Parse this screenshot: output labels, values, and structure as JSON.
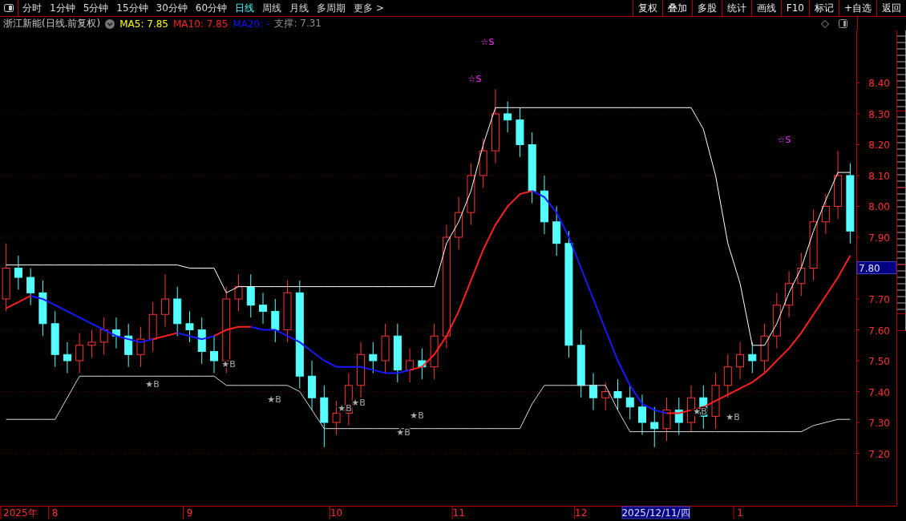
{
  "toolbar": {
    "periods": [
      {
        "label": "分时",
        "selected": false
      },
      {
        "label": "1分钟",
        "selected": false
      },
      {
        "label": "5分钟",
        "selected": false
      },
      {
        "label": "15分钟",
        "selected": false
      },
      {
        "label": "30分钟",
        "selected": false
      },
      {
        "label": "60分钟",
        "selected": false
      },
      {
        "label": "日线",
        "selected": true
      },
      {
        "label": "周线",
        "selected": false
      },
      {
        "label": "月线",
        "selected": false
      },
      {
        "label": "多周期",
        "selected": false
      },
      {
        "label": "更多 >",
        "selected": false
      }
    ],
    "buttons": [
      "复权",
      "叠加",
      "多股",
      "统计",
      "画线",
      "F10",
      "标记",
      "+自选",
      "返回"
    ]
  },
  "legend": {
    "title": "浙江新能(日线.前复权)",
    "items": [
      {
        "label": "MA5: 7.85",
        "color": "#ffff00"
      },
      {
        "label": "MA10: 7.85",
        "color": "#ff2020"
      },
      {
        "label": "MA20: -",
        "color": "#1010ff"
      },
      {
        "label": "支撑: 7.31",
        "color": "#909090"
      }
    ]
  },
  "chart": {
    "year_label": "2025年",
    "current_price": "7.80",
    "cursor_date": "2025/12/11/四",
    "chart_data": {
      "type": "candlestick",
      "grid": true,
      "ylim": [
        7.03,
        8.57
      ],
      "categories": [
        null,
        null,
        null,
        null,
        "8",
        null,
        null,
        null,
        null,
        null,
        null,
        null,
        null,
        null,
        null,
        "9",
        null,
        null,
        null,
        null,
        null,
        null,
        null,
        null,
        null,
        null,
        null,
        "10",
        null,
        null,
        null,
        null,
        null,
        null,
        null,
        null,
        null,
        "11",
        null,
        null,
        null,
        null,
        null,
        null,
        null,
        null,
        null,
        "12",
        null,
        null,
        null,
        null,
        null,
        null,
        null,
        null,
        null,
        null,
        null,
        null,
        "1",
        null,
        null,
        null,
        null,
        null,
        null,
        null,
        null,
        null
      ],
      "yticks": [
        {
          "value": 7.2,
          "label": "7.20"
        },
        {
          "value": 7.3,
          "label": "7.30"
        },
        {
          "value": 7.4,
          "label": "7.40"
        },
        {
          "value": 7.5,
          "label": "7.50"
        },
        {
          "value": 7.6,
          "label": "7.60"
        },
        {
          "value": 7.7,
          "label": "7.70"
        },
        {
          "value": 7.9,
          "label": "7.90"
        },
        {
          "value": 8.0,
          "label": "8.00"
        },
        {
          "value": 8.1,
          "label": "8.10"
        },
        {
          "value": 8.2,
          "label": "8.20"
        },
        {
          "value": 8.3,
          "label": "8.30"
        },
        {
          "value": 8.4,
          "label": "8.40"
        }
      ],
      "ohlc": [
        [
          7.7,
          7.88,
          7.66,
          7.8
        ],
        [
          7.8,
          7.84,
          7.73,
          7.77
        ],
        [
          7.77,
          7.8,
          7.68,
          7.72
        ],
        [
          7.72,
          7.76,
          7.58,
          7.62
        ],
        [
          7.62,
          7.66,
          7.48,
          7.52
        ],
        [
          7.52,
          7.56,
          7.46,
          7.5
        ],
        [
          7.5,
          7.59,
          7.46,
          7.55
        ],
        [
          7.55,
          7.6,
          7.51,
          7.56
        ],
        [
          7.56,
          7.64,
          7.52,
          7.6
        ],
        [
          7.6,
          7.64,
          7.54,
          7.58
        ],
        [
          7.58,
          7.62,
          7.48,
          7.52
        ],
        [
          7.52,
          7.61,
          7.48,
          7.57
        ],
        [
          7.57,
          7.69,
          7.53,
          7.65
        ],
        [
          7.65,
          7.78,
          7.61,
          7.7
        ],
        [
          7.7,
          7.74,
          7.58,
          7.62
        ],
        [
          7.62,
          7.66,
          7.56,
          7.6
        ],
        [
          7.6,
          7.64,
          7.49,
          7.53
        ],
        [
          7.53,
          7.58,
          7.46,
          7.5
        ],
        [
          7.5,
          7.74,
          7.46,
          7.7
        ],
        [
          7.7,
          7.78,
          7.66,
          7.74
        ],
        [
          7.74,
          7.78,
          7.64,
          7.68
        ],
        [
          7.68,
          7.72,
          7.62,
          7.66
        ],
        [
          7.66,
          7.7,
          7.56,
          7.6
        ],
        [
          7.6,
          7.76,
          7.56,
          7.72
        ],
        [
          7.72,
          7.76,
          7.41,
          7.45
        ],
        [
          7.45,
          7.5,
          7.34,
          7.38
        ],
        [
          7.38,
          7.42,
          7.22,
          7.3
        ],
        [
          7.3,
          7.37,
          7.26,
          7.33
        ],
        [
          7.33,
          7.46,
          7.29,
          7.42
        ],
        [
          7.42,
          7.56,
          7.38,
          7.52
        ],
        [
          7.52,
          7.56,
          7.46,
          7.5
        ],
        [
          7.5,
          7.62,
          7.46,
          7.58
        ],
        [
          7.58,
          7.62,
          7.43,
          7.47
        ],
        [
          7.47,
          7.54,
          7.43,
          7.5
        ],
        [
          7.5,
          7.54,
          7.44,
          7.48
        ],
        [
          7.48,
          7.62,
          7.44,
          7.58
        ],
        [
          7.58,
          7.94,
          7.54,
          7.9
        ],
        [
          7.9,
          8.03,
          7.86,
          7.98
        ],
        [
          7.98,
          8.14,
          7.94,
          8.1
        ],
        [
          8.1,
          8.22,
          8.06,
          8.18
        ],
        [
          8.18,
          8.38,
          8.14,
          8.3
        ],
        [
          8.3,
          8.34,
          8.24,
          8.28
        ],
        [
          8.28,
          8.32,
          8.16,
          8.2
        ],
        [
          8.2,
          8.24,
          8.01,
          8.05
        ],
        [
          8.05,
          8.1,
          7.91,
          7.95
        ],
        [
          7.95,
          8.0,
          7.84,
          7.88
        ],
        [
          7.88,
          7.92,
          7.51,
          7.55
        ],
        [
          7.55,
          7.6,
          7.38,
          7.42
        ],
        [
          7.42,
          7.46,
          7.34,
          7.38
        ],
        [
          7.38,
          7.43,
          7.34,
          7.4
        ],
        [
          7.4,
          7.44,
          7.34,
          7.38
        ],
        [
          7.38,
          7.42,
          7.31,
          7.35
        ],
        [
          7.35,
          7.39,
          7.26,
          7.3
        ],
        [
          7.3,
          7.35,
          7.22,
          7.28
        ],
        [
          7.28,
          7.38,
          7.24,
          7.34
        ],
        [
          7.34,
          7.38,
          7.26,
          7.3
        ],
        [
          7.3,
          7.42,
          7.27,
          7.38
        ],
        [
          7.38,
          7.42,
          7.28,
          7.32
        ],
        [
          7.32,
          7.46,
          7.28,
          7.42
        ],
        [
          7.42,
          7.52,
          7.38,
          7.48
        ],
        [
          7.48,
          7.56,
          7.44,
          7.52
        ],
        [
          7.52,
          7.56,
          7.46,
          7.5
        ],
        [
          7.5,
          7.62,
          7.46,
          7.58
        ],
        [
          7.58,
          7.72,
          7.54,
          7.68
        ],
        [
          7.68,
          7.79,
          7.64,
          7.75
        ],
        [
          7.75,
          7.85,
          7.71,
          7.8
        ],
        [
          7.8,
          7.99,
          7.76,
          7.95
        ],
        [
          7.95,
          8.04,
          7.91,
          8.0
        ],
        [
          8.0,
          8.18,
          7.96,
          8.1
        ],
        [
          8.1,
          8.14,
          7.88,
          7.92
        ]
      ],
      "series": [
        {
          "type": "line",
          "color": "#ff2020",
          "values": [
            7.67,
            7.69,
            7.71,
            null,
            null,
            null,
            null,
            null,
            null,
            null,
            null,
            null,
            7.57,
            7.58,
            7.59,
            null,
            null,
            7.58,
            7.6,
            7.61,
            7.61,
            null,
            null,
            null,
            null,
            null,
            null,
            null,
            null,
            null,
            null,
            null,
            null,
            7.47,
            7.48,
            7.52,
            7.58,
            7.66,
            7.76,
            7.86,
            7.94,
            8.0,
            8.04,
            8.05,
            null,
            null,
            null,
            null,
            null,
            null,
            null,
            null,
            null,
            null,
            7.33,
            7.33,
            7.34,
            7.35,
            7.37,
            7.39,
            7.41,
            7.43,
            7.46,
            7.5,
            7.54,
            7.59,
            7.65,
            7.71,
            7.77,
            7.84
          ]
        },
        {
          "type": "line",
          "color": "#1818ff",
          "values": [
            null,
            null,
            7.71,
            7.7,
            7.68,
            7.66,
            7.64,
            7.62,
            7.6,
            7.58,
            7.57,
            7.56,
            7.57,
            null,
            7.59,
            7.58,
            7.57,
            7.58,
            null,
            null,
            7.61,
            7.6,
            7.6,
            7.58,
            7.56,
            7.53,
            7.5,
            7.48,
            7.48,
            7.48,
            7.47,
            7.46,
            7.46,
            7.47,
            null,
            null,
            null,
            null,
            null,
            null,
            null,
            null,
            null,
            8.05,
            8.03,
            7.98,
            7.9,
            7.8,
            7.7,
            7.6,
            7.5,
            7.42,
            7.36,
            7.34,
            7.33,
            null,
            null,
            null,
            null,
            null,
            null,
            null,
            null,
            null,
            null,
            null,
            null,
            null,
            null,
            null
          ]
        },
        {
          "type": "line",
          "color": "#ffffff",
          "values": [
            7.81,
            7.81,
            7.81,
            7.81,
            7.81,
            7.81,
            7.81,
            7.81,
            7.81,
            7.81,
            7.81,
            7.81,
            7.81,
            7.81,
            7.81,
            7.8,
            7.8,
            7.8,
            7.72,
            7.74,
            7.74,
            7.74,
            7.74,
            7.74,
            7.74,
            7.74,
            7.74,
            7.74,
            7.74,
            7.74,
            7.74,
            7.74,
            7.74,
            7.74,
            7.74,
            7.74,
            7.88,
            7.95,
            8.05,
            8.2,
            8.32,
            8.32,
            8.32,
            8.32,
            8.32,
            8.32,
            8.32,
            8.32,
            8.32,
            8.32,
            8.32,
            8.32,
            8.32,
            8.32,
            8.32,
            8.32,
            8.32,
            8.25,
            8.1,
            7.88,
            7.75,
            7.55,
            7.55,
            7.62,
            7.72,
            7.8,
            7.92,
            8.02,
            8.11,
            8.11
          ]
        },
        {
          "type": "line",
          "color": "#d8d8d8",
          "values": [
            7.31,
            7.31,
            7.31,
            7.31,
            7.31,
            7.38,
            7.45,
            7.45,
            7.45,
            7.45,
            7.45,
            7.45,
            7.45,
            7.45,
            7.45,
            7.45,
            7.45,
            7.45,
            7.42,
            7.42,
            7.42,
            7.42,
            7.42,
            7.42,
            7.4,
            7.34,
            7.28,
            7.28,
            7.28,
            7.28,
            7.28,
            7.28,
            7.28,
            7.28,
            7.28,
            7.28,
            7.28,
            7.28,
            7.28,
            7.28,
            7.28,
            7.28,
            7.28,
            7.36,
            7.42,
            7.42,
            7.42,
            7.42,
            7.42,
            7.42,
            7.34,
            7.27,
            7.27,
            7.27,
            7.27,
            7.27,
            7.27,
            7.27,
            7.27,
            7.27,
            7.27,
            7.27,
            7.27,
            7.27,
            7.27,
            7.27,
            7.29,
            7.3,
            7.31,
            7.31
          ]
        }
      ],
      "annotations": [
        "★B",
        "★B",
        "★B",
        "★B",
        "★B",
        "★B",
        "★B",
        "☆S",
        "☆S",
        "★B",
        "★B",
        "☆S"
      ]
    }
  }
}
